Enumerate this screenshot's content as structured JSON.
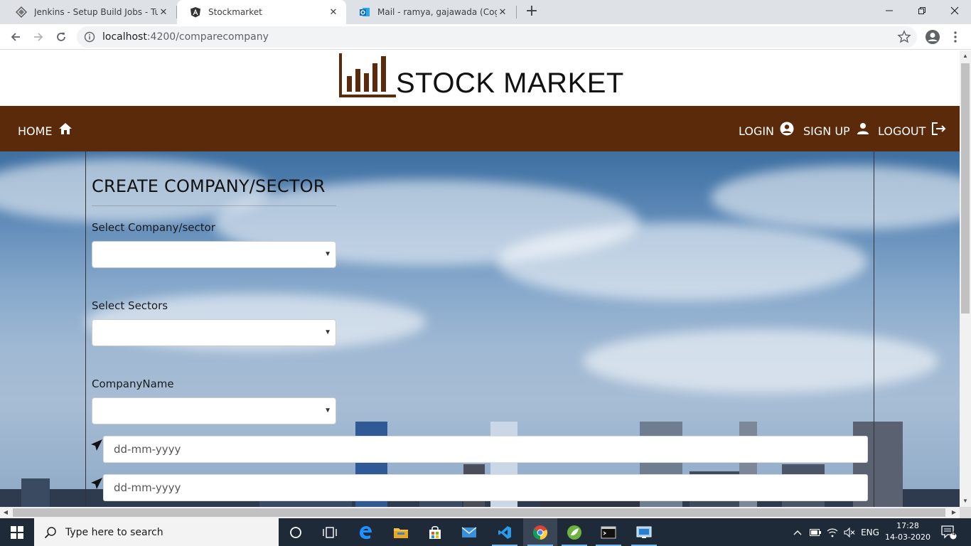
{
  "browser": {
    "tabs": [
      {
        "title": "Jenkins - Setup Build Jobs - Tuto",
        "icon": "jenkins-icon",
        "active": false
      },
      {
        "title": "Stockmarket",
        "icon": "angular-icon",
        "active": true
      },
      {
        "title": "Mail - ramya, gajawada (Cogniza",
        "icon": "outlook-icon",
        "active": false
      }
    ],
    "new_tab": "+",
    "url_host": "localhost",
    "url_path": ":4200/comparecompany"
  },
  "header": {
    "brand": "STOCK MARKET"
  },
  "nav": {
    "home": "HOME",
    "login": "LOGIN",
    "signup": "SIGN UP",
    "logout": "LOGOUT"
  },
  "form": {
    "title": "CREATE COMPANY/SECTOR",
    "select_company_label": "Select Company/sector",
    "select_sectors_label": "Select Sectors",
    "company_name_label": "CompanyName",
    "date_from_placeholder": "dd-mm-yyyy",
    "date_to_placeholder": "dd-mm-yyyy"
  },
  "taskbar": {
    "search_placeholder": "Type here to search",
    "lang": "ENG",
    "time": "17:28",
    "date": "14-03-2020",
    "notifications": "4"
  },
  "colors": {
    "nav_bg": "#5b2a0b",
    "taskbar_bg": "#1f2a38"
  }
}
